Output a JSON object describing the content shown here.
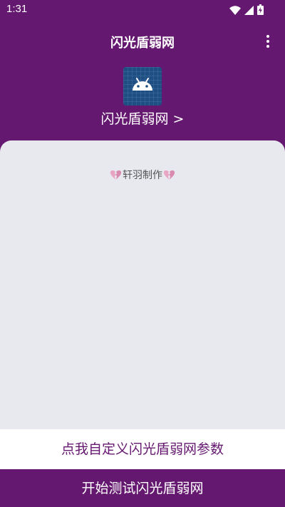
{
  "status_bar": {
    "time": "1:31",
    "icons": [
      "wifi-icon",
      "signal-icon",
      "battery-icon"
    ]
  },
  "app_bar": {
    "title": "闪光盾弱网",
    "menu_icon": "more-vert-icon"
  },
  "app_header": {
    "icon": "android-icon",
    "name": "闪光盾弱网 >"
  },
  "content": {
    "credit": "轩羽制作",
    "credit_icon": "broken-heart-icon"
  },
  "actions": {
    "customize_label": "点我自定义闪光盾弱网参数",
    "start_label": "开始测试闪光盾弱网"
  },
  "colors": {
    "primary": "#65186f",
    "surface": "#e8e9ee",
    "on_primary": "#ffffff"
  }
}
